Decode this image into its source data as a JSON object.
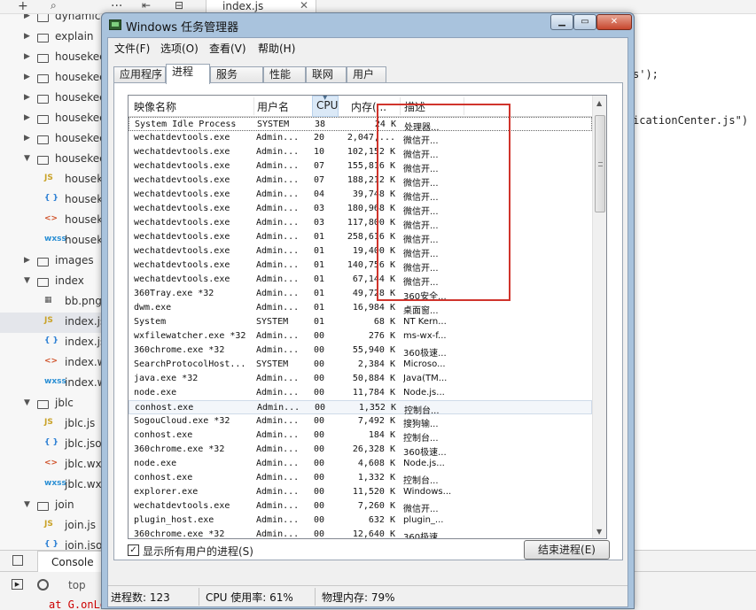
{
  "ide": {
    "editor_tab": "index.js",
    "tree": [
      {
        "type": "folder",
        "label": "dynamic",
        "open": false
      },
      {
        "type": "folder",
        "label": "explain",
        "open": false
      },
      {
        "type": "folder",
        "label": "housekee",
        "open": false
      },
      {
        "type": "folder",
        "label": "housekee",
        "open": false
      },
      {
        "type": "folder",
        "label": "housekee",
        "open": false
      },
      {
        "type": "folder",
        "label": "housekee",
        "open": false
      },
      {
        "type": "folder",
        "label": "housekee",
        "open": false
      },
      {
        "type": "folder",
        "label": "housekee",
        "open": true
      },
      {
        "type": "js",
        "label": "housekee"
      },
      {
        "type": "json",
        "label": "housekee"
      },
      {
        "type": "wxml",
        "label": "housekee"
      },
      {
        "type": "wxss",
        "label": "housekee"
      },
      {
        "type": "folder",
        "label": "images",
        "open": false
      },
      {
        "type": "folder",
        "label": "index",
        "open": true
      },
      {
        "type": "png",
        "label": "bb.png"
      },
      {
        "type": "js",
        "label": "index.js",
        "selected": true
      },
      {
        "type": "json",
        "label": "index.js"
      },
      {
        "type": "wxml",
        "label": "index.w"
      },
      {
        "type": "wxss",
        "label": "index.w"
      },
      {
        "type": "folder",
        "label": "jblc",
        "open": true
      },
      {
        "type": "js",
        "label": "jblc.js"
      },
      {
        "type": "json",
        "label": "jblc.json"
      },
      {
        "type": "wxml",
        "label": "jblc.wxm"
      },
      {
        "type": "wxss",
        "label": "jblc.wxs"
      },
      {
        "type": "folder",
        "label": "join",
        "open": true
      },
      {
        "type": "js",
        "label": "join.js"
      },
      {
        "type": "json",
        "label": "join.json"
      }
    ],
    "icon_glyphs": {
      "js": "JS",
      "json": "{ }",
      "wxml": "<>",
      "wxss": "wxss",
      "png": "▦"
    },
    "code_lines": [
      "s');",
      "icationCenter.js\")"
    ],
    "console_tab": "Console",
    "console_context": "top",
    "console_error": "at G.onLo"
  },
  "taskmgr": {
    "title": "Windows 任务管理器",
    "menu": [
      "文件(F)",
      "选项(O)",
      "查看(V)",
      "帮助(H)"
    ],
    "tabs": [
      "应用程序",
      "进程",
      "服务",
      "性能",
      "联网",
      "用户"
    ],
    "active_tab": "进程",
    "columns": [
      "映像名称",
      "用户名",
      "CPU",
      "内存(...",
      "描述"
    ],
    "rows": [
      [
        "System Idle Process",
        "SYSTEM",
        "38",
        "24 K",
        "处理器..."
      ],
      [
        "wechatdevtools.exe",
        "Admin...",
        "20",
        "2,047,...",
        "微信开..."
      ],
      [
        "wechatdevtools.exe",
        "Admin...",
        "10",
        "102,152 K",
        "微信开..."
      ],
      [
        "wechatdevtools.exe",
        "Admin...",
        "07",
        "155,816 K",
        "微信开..."
      ],
      [
        "wechatdevtools.exe",
        "Admin...",
        "07",
        "188,212 K",
        "微信开..."
      ],
      [
        "wechatdevtools.exe",
        "Admin...",
        "04",
        "39,748 K",
        "微信开..."
      ],
      [
        "wechatdevtools.exe",
        "Admin...",
        "03",
        "180,968 K",
        "微信开..."
      ],
      [
        "wechatdevtools.exe",
        "Admin...",
        "03",
        "117,800 K",
        "微信开..."
      ],
      [
        "wechatdevtools.exe",
        "Admin...",
        "01",
        "258,616 K",
        "微信开..."
      ],
      [
        "wechatdevtools.exe",
        "Admin...",
        "01",
        "19,400 K",
        "微信开..."
      ],
      [
        "wechatdevtools.exe",
        "Admin...",
        "01",
        "140,756 K",
        "微信开..."
      ],
      [
        "wechatdevtools.exe",
        "Admin...",
        "01",
        "67,144 K",
        "微信开..."
      ],
      [
        "360Tray.exe *32",
        "Admin...",
        "01",
        "49,728 K",
        "360安全..."
      ],
      [
        "dwm.exe",
        "Admin...",
        "01",
        "16,984 K",
        "桌面窗..."
      ],
      [
        "System",
        "SYSTEM",
        "01",
        "68 K",
        "NT Kern..."
      ],
      [
        "wxfilewatcher.exe *32",
        "Admin...",
        "00",
        "276 K",
        "ms-wx-f..."
      ],
      [
        "360chrome.exe *32",
        "Admin...",
        "00",
        "55,940 K",
        "360极速..."
      ],
      [
        "SearchProtocolHost...",
        "SYSTEM",
        "00",
        "2,384 K",
        "Microso..."
      ],
      [
        "java.exe *32",
        "Admin...",
        "00",
        "50,884 K",
        "Java(TM..."
      ],
      [
        "node.exe",
        "Admin...",
        "00",
        "11,784 K",
        "Node.js..."
      ],
      [
        "conhost.exe",
        "Admin...",
        "00",
        "1,352 K",
        "控制台..."
      ],
      [
        "SogouCloud.exe *32",
        "Admin...",
        "00",
        "7,492 K",
        "搜狗输..."
      ],
      [
        "conhost.exe",
        "Admin...",
        "00",
        "184 K",
        "控制台..."
      ],
      [
        "360chrome.exe *32",
        "Admin...",
        "00",
        "26,328 K",
        "360极速..."
      ],
      [
        "node.exe",
        "Admin...",
        "00",
        "4,608 K",
        "Node.js..."
      ],
      [
        "conhost.exe",
        "Admin...",
        "00",
        "1,332 K",
        "控制台..."
      ],
      [
        "explorer.exe",
        "Admin...",
        "00",
        "11,520 K",
        "Windows..."
      ],
      [
        "wechatdevtools.exe",
        "Admin...",
        "00",
        "7,260 K",
        "微信开..."
      ],
      [
        "plugin_host.exe",
        "Admin...",
        "00",
        "632 K",
        "plugin_..."
      ],
      [
        "360chrome.exe *32",
        "Admin...",
        "00",
        "12,640 K",
        "360极速..."
      ]
    ],
    "show_all_label": "显示所有用户的进程(S)",
    "show_all_checked": true,
    "end_process_label": "结束进程(E)",
    "status": {
      "process_count": "进程数: 123",
      "cpu_usage": "CPU 使用率: 61%",
      "physical_memory": "物理内存: 79%"
    },
    "colors": {
      "frame": "#a9c3dd",
      "close_button": "#c7462d",
      "annotation": "#d0342c"
    }
  }
}
